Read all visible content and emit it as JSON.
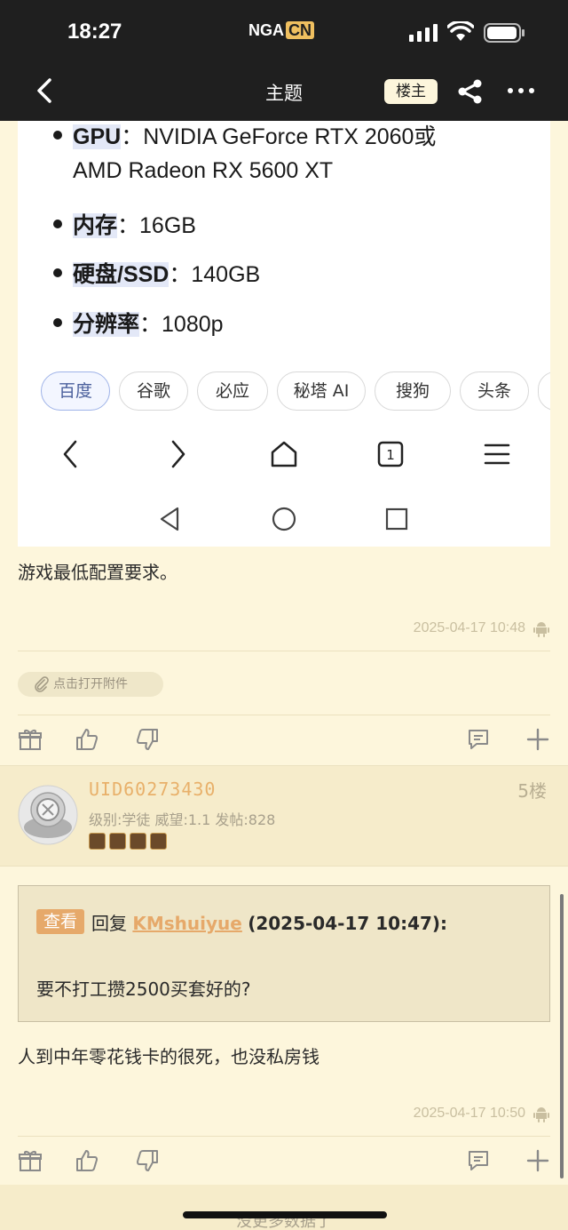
{
  "status_bar": {
    "time": "18:27",
    "logo_main": "NGA",
    "logo_suffix": "CN"
  },
  "nav_bar": {
    "title": "主题",
    "op_button": "楼主"
  },
  "screenshot": {
    "specs": [
      {
        "key": "GPU",
        "sep": "：",
        "value": "NVIDIA GeForce RTX 2060或"
      },
      {
        "key": "内存",
        "sep": "：",
        "value": "16GB"
      },
      {
        "key": "硬盘/SSD",
        "sep": "：",
        "value": "140GB"
      },
      {
        "key": "分辨率",
        "sep": "：",
        "value": "1080p"
      }
    ],
    "gpu_line2": "AMD Radeon RX 5600 XT",
    "engines": [
      "百度",
      "谷歌",
      "必应",
      "秘塔 AI",
      "搜狗",
      "头条"
    ],
    "tab_count": "1"
  },
  "post4": {
    "text": "游戏最低配置要求。",
    "time": "2025-04-17 10:48",
    "attachment_label": "点击打开附件"
  },
  "post5": {
    "uid": "UID60273430",
    "floor": "5楼",
    "level_info": "级别:学徒  威望:1.1  发帖:828",
    "quote": {
      "view_tag": "查看",
      "reply_prefix": "回复",
      "reply_user": "KMshuiyue",
      "reply_date": "(2025-04-17 10:47):",
      "text": "要不打工攒2500买套好的?"
    },
    "text": "人到中年零花钱卡的很死，也没私房钱",
    "time": "2025-04-17 10:50"
  },
  "footer": {
    "no_more": "没更多数据了"
  },
  "colors": {
    "background": "#fdf6dc",
    "header": "#1f1f1f",
    "accent": "#e6a96a"
  }
}
